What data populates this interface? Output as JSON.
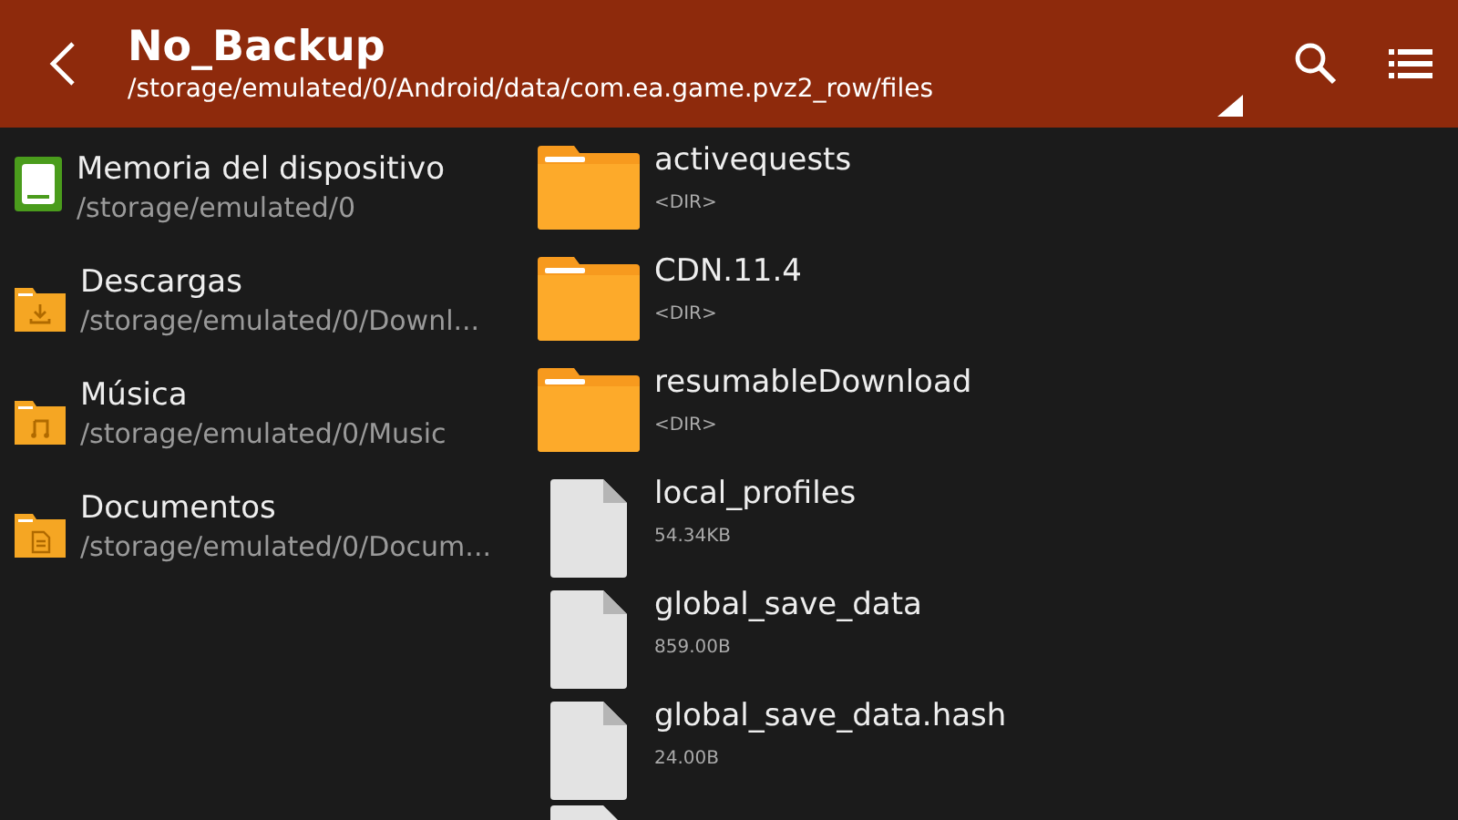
{
  "header": {
    "title": "No_Backup",
    "path": "/storage/emulated/0/Android/data/com.ea.game.pvz2_row/files"
  },
  "sidebar": {
    "items": [
      {
        "kind": "storage",
        "name": "Memoria del dispositivo",
        "path": "/storage/emulated/0"
      },
      {
        "kind": "download",
        "name": "Descargas",
        "path": "/storage/emulated/0/Downl..."
      },
      {
        "kind": "music",
        "name": "Música",
        "path": "/storage/emulated/0/Music"
      },
      {
        "kind": "document",
        "name": "Documentos",
        "path": "/storage/emulated/0/Docum..."
      }
    ]
  },
  "files": [
    {
      "kind": "folder",
      "name": "activequests",
      "info": "<DIR>"
    },
    {
      "kind": "folder",
      "name": "CDN.11.4",
      "info": "<DIR>"
    },
    {
      "kind": "folder",
      "name": "resumableDownload",
      "info": "<DIR>"
    },
    {
      "kind": "file",
      "name": "local_profiles",
      "info": "54.34KB"
    },
    {
      "kind": "file",
      "name": "global_save_data",
      "info": "859.00B"
    },
    {
      "kind": "file",
      "name": "global_save_data.hash",
      "info": "24.00B"
    }
  ]
}
